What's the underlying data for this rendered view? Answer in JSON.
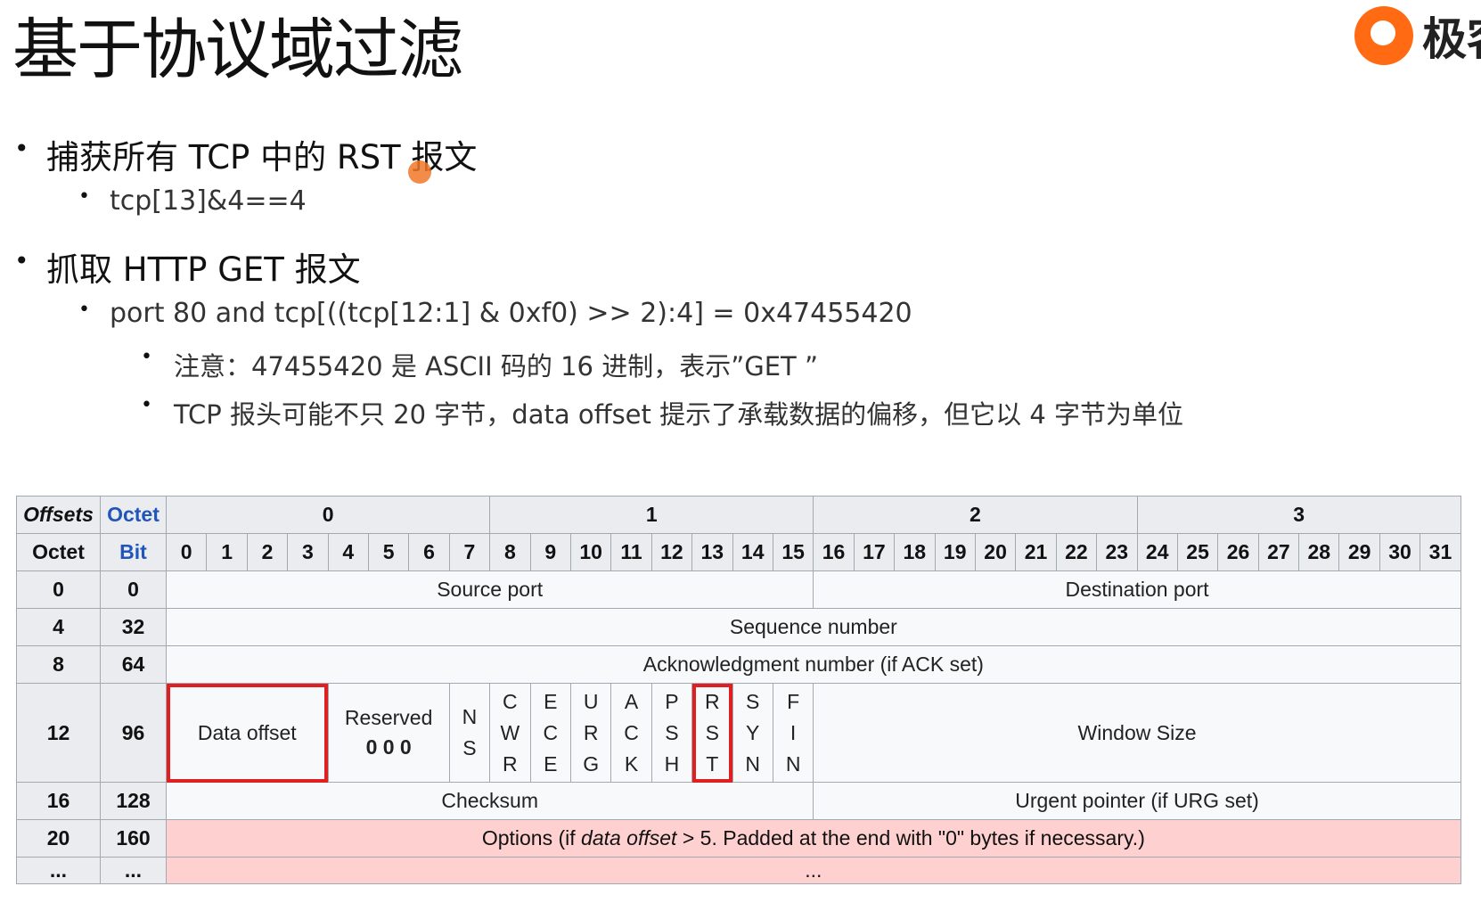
{
  "title": "基于协议域过滤",
  "logo_text": "极客",
  "bullets": [
    {
      "level": 1,
      "text": "捕获所有 TCP 中的 RST 报文"
    },
    {
      "level": 2,
      "text": "tcp[13]&4==4"
    },
    {
      "level": 1,
      "text": "抓取 HTTP GET 报文"
    },
    {
      "level": 2,
      "text": "port 80 and tcp[((tcp[12:1] & 0xf0) >> 2):4] = 0x47455420"
    },
    {
      "level": 3,
      "text": "注意：47455420 是 ASCII 码的 16 进制，表示”GET ”"
    },
    {
      "level": 3,
      "text": "TCP 报头可能不只 20 字节，data offset 提示了承载数据的偏移，但它以 4 字节为单位"
    }
  ],
  "table": {
    "corner_offsets": "Offsets",
    "corner_octet": "Octet",
    "octet_label": "Octet",
    "bit_label": "Bit",
    "octet_headers": [
      "0",
      "1",
      "2",
      "3"
    ],
    "bit_headers": [
      "0",
      "1",
      "2",
      "3",
      "4",
      "5",
      "6",
      "7",
      "8",
      "9",
      "10",
      "11",
      "12",
      "13",
      "14",
      "15",
      "16",
      "17",
      "18",
      "19",
      "20",
      "21",
      "22",
      "23",
      "24",
      "25",
      "26",
      "27",
      "28",
      "29",
      "30",
      "31"
    ],
    "rows": [
      {
        "octet": "0",
        "bit": "0",
        "a": "Source port",
        "b": "Destination port"
      },
      {
        "octet": "4",
        "bit": "32",
        "a": "Sequence number"
      },
      {
        "octet": "8",
        "bit": "64",
        "a": "Acknowledgment number (if ACK set)"
      },
      {
        "octet": "12",
        "bit": "96",
        "data_offset": "Data offset",
        "reserved": "Reserved",
        "reserved_bits": "0 0 0",
        "flags": [
          [
            "N",
            "S"
          ],
          [
            "C",
            "W",
            "R"
          ],
          [
            "E",
            "C",
            "E"
          ],
          [
            "U",
            "R",
            "G"
          ],
          [
            "A",
            "C",
            "K"
          ],
          [
            "P",
            "S",
            "H"
          ],
          [
            "R",
            "S",
            "T"
          ],
          [
            "S",
            "Y",
            "N"
          ],
          [
            "F",
            "I",
            "N"
          ]
        ],
        "window": "Window Size"
      },
      {
        "octet": "16",
        "bit": "128",
        "a": "Checksum",
        "b": "Urgent pointer (if URG set)"
      },
      {
        "octet": "20",
        "bit": "160",
        "opt_pre": "Options (if ",
        "opt_ital": "data offset",
        "opt_post": " > 5. Padded at the end with \"0\" bytes if necessary.)"
      },
      {
        "octet": "...",
        "bit": "...",
        "a": "..."
      }
    ]
  }
}
